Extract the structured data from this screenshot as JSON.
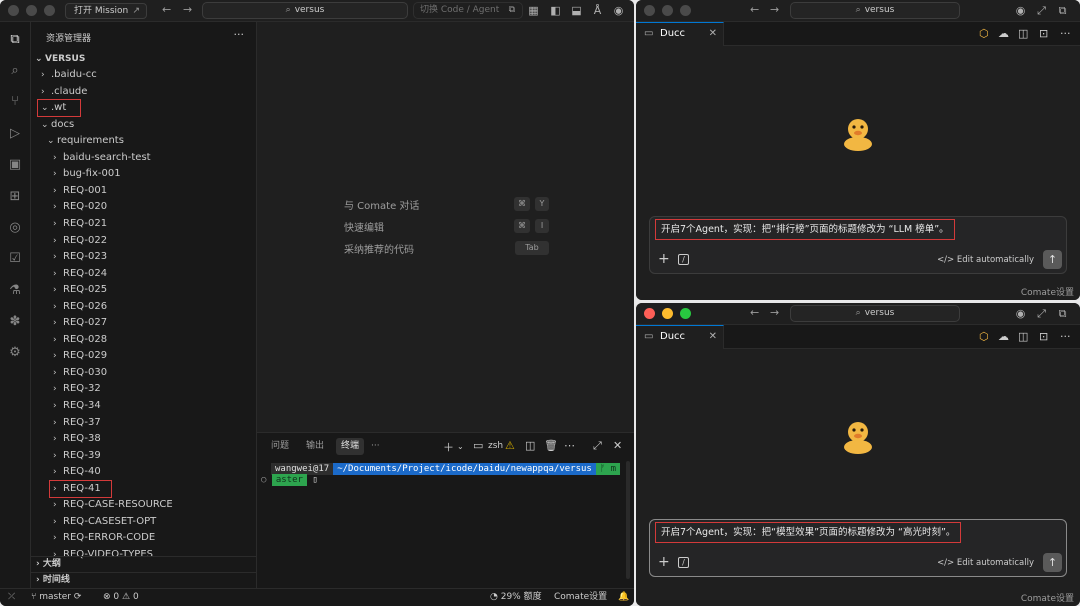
{
  "main_window": {
    "mission_button": "打开 Mission",
    "mission_button_icon": "external-link-icon",
    "search": "versus",
    "mode_switch": "切换 Code / Agent",
    "explorer": {
      "title": "资源管理器",
      "root": "VERSUS",
      "items": [
        {
          "label": ".baidu-cc",
          "chev": "›",
          "depth": 1
        },
        {
          "label": ".claude",
          "chev": "›",
          "depth": 1
        },
        {
          "label": ".wt",
          "chev": "⌄",
          "depth": 1
        },
        {
          "label": "docs",
          "chev": "⌄",
          "depth": 1
        },
        {
          "label": "requirements",
          "chev": "⌄",
          "depth": 2
        },
        {
          "label": "baidu-search-test",
          "chev": "›",
          "depth": 3
        },
        {
          "label": "bug-fix-001",
          "chev": "›",
          "depth": 3
        },
        {
          "label": "REQ-001",
          "chev": "›",
          "depth": 3
        },
        {
          "label": "REQ-020",
          "chev": "›",
          "depth": 3
        },
        {
          "label": "REQ-021",
          "chev": "›",
          "depth": 3
        },
        {
          "label": "REQ-022",
          "chev": "›",
          "depth": 3
        },
        {
          "label": "REQ-023",
          "chev": "›",
          "depth": 3
        },
        {
          "label": "REQ-024",
          "chev": "›",
          "depth": 3
        },
        {
          "label": "REQ-025",
          "chev": "›",
          "depth": 3
        },
        {
          "label": "REQ-026",
          "chev": "›",
          "depth": 3
        },
        {
          "label": "REQ-027",
          "chev": "›",
          "depth": 3
        },
        {
          "label": "REQ-028",
          "chev": "›",
          "depth": 3
        },
        {
          "label": "REQ-029",
          "chev": "›",
          "depth": 3
        },
        {
          "label": "REQ-030",
          "chev": "›",
          "depth": 3
        },
        {
          "label": "REQ-32",
          "chev": "›",
          "depth": 3
        },
        {
          "label": "REQ-34",
          "chev": "›",
          "depth": 3
        },
        {
          "label": "REQ-37",
          "chev": "›",
          "depth": 3
        },
        {
          "label": "REQ-38",
          "chev": "›",
          "depth": 3
        },
        {
          "label": "REQ-39",
          "chev": "›",
          "depth": 3
        },
        {
          "label": "REQ-40",
          "chev": "›",
          "depth": 3
        },
        {
          "label": "REQ-41",
          "chev": "›",
          "depth": 3
        },
        {
          "label": "REQ-CASE-RESOURCE",
          "chev": "›",
          "depth": 3
        },
        {
          "label": "REQ-CASESET-OPT",
          "chev": "›",
          "depth": 3
        },
        {
          "label": "REQ-ERROR-CODE",
          "chev": "›",
          "depth": 3
        },
        {
          "label": "REQ-VIDEO-TYPES",
          "chev": "›",
          "depth": 3
        }
      ],
      "highlighted": [
        ".wt",
        "REQ-41"
      ],
      "outline": "大纲",
      "timeline": "时间线"
    },
    "editor_hints": [
      {
        "label": "与 Comate 对话",
        "keys": [
          "⌘",
          "Y"
        ]
      },
      {
        "label": "快速编辑",
        "keys": [
          "⌘",
          "I"
        ]
      },
      {
        "label": "采纳推荐的代码",
        "keys": [
          "Tab"
        ]
      }
    ],
    "panel": {
      "tabs": [
        "问题",
        "输出",
        "终端"
      ],
      "active_tab": "终端",
      "more": "···",
      "shell": "zsh",
      "terminal": {
        "user": "wangwei@17",
        "path": "~/Documents/Project/icode/baidu/newappqa/versus",
        "git_glyph": "ᚠ m",
        "branch": "aster"
      }
    },
    "statusbar": {
      "branch": "master",
      "errors": "0",
      "warnings": "0",
      "quota": "29% 额度",
      "settings": "Comate设置"
    }
  },
  "chat_windows": [
    {
      "search": "versus",
      "tab": "Ducc",
      "message": "开启7个Agent，实现：把“排行榜”页面的标题修改为 “LLM 榜单”。",
      "edit_mode": "Edit automatically",
      "footer": "Comate设置",
      "focused": false
    },
    {
      "search": "versus",
      "tab": "Ducc",
      "message": "开启7个Agent，实现：把“模型效果”页面的标题修改为 “高光时刻”。",
      "edit_mode": "Edit automatically",
      "footer": "Comate设置",
      "focused": true
    }
  ],
  "colors": {
    "accent": "#0078d4",
    "highlight_box": "#d33a3a",
    "terminal_user_bg": "#2e2e2e",
    "terminal_path_bg": "#1b6ac9",
    "terminal_git_bg": "#2da44e",
    "duck_body": "#f2b742",
    "duck_beak": "#e07b2a"
  }
}
